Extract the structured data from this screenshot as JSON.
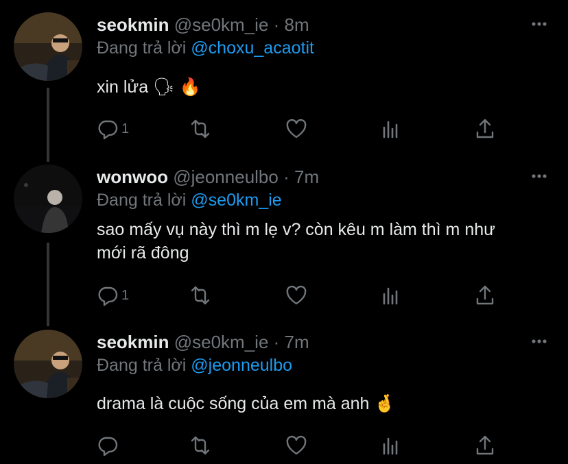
{
  "tweets": [
    {
      "name": "seokmin",
      "handle": "@se0km_ie",
      "dot": "·",
      "time": "8m",
      "replying_label": "Đang trả lời",
      "replying_to": "@choxu_acaotit",
      "text": "xin lửa 🗣 🔥",
      "actions": {
        "reply_count": "1",
        "retweet_count": "",
        "like_count": ""
      }
    },
    {
      "name": "wonwoo",
      "handle": "@jeonneulbo",
      "dot": "·",
      "time": "7m",
      "replying_label": "Đang trả lời",
      "replying_to": "@se0km_ie",
      "text": "sao mấy vụ này thì m lẹ v? còn kêu m làm thì m như mới rã đông",
      "actions": {
        "reply_count": "1",
        "retweet_count": "",
        "like_count": ""
      }
    },
    {
      "name": "seokmin",
      "handle": "@se0km_ie",
      "dot": "·",
      "time": "7m",
      "replying_label": "Đang trả lời",
      "replying_to": "@jeonneulbo",
      "text": "drama là cuộc sống của em mà anh 🤞",
      "actions": {
        "reply_count": "",
        "retweet_count": "",
        "like_count": ""
      }
    }
  ],
  "icons": {
    "reply": "reply-icon",
    "retweet": "retweet-icon",
    "like": "like-icon",
    "views": "views-icon",
    "share": "share-icon",
    "more": "more-icon"
  },
  "colors": {
    "background": "#000000",
    "text": "#e7e9ea",
    "secondary": "#71767b",
    "link": "#1d9bf0",
    "thread_line": "#333639"
  }
}
